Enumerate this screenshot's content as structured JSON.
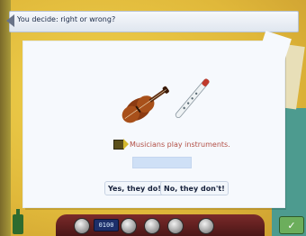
{
  "header": {
    "title": "You decide: right or wrong?",
    "icon": "back-arrow-icon"
  },
  "prompt": {
    "caption": "Musicians play instruments.",
    "images": [
      "violin",
      "recorder"
    ],
    "answer_value": ""
  },
  "buttons": {
    "yes_label": "Yes, they do!",
    "no_label": "No, they don't!"
  },
  "toolbar": {
    "clock_text": "0100",
    "tools": [
      "home-icon",
      "clock-icon",
      "headphones-icon",
      "chat-icon",
      "notebook-icon",
      "folder-icon"
    ]
  },
  "colors": {
    "accent_caption": "#b24f45",
    "card_bg": "#f6f9fd",
    "input_fill": "#cfe0f6",
    "toolbar_bg": "#6a2222"
  }
}
